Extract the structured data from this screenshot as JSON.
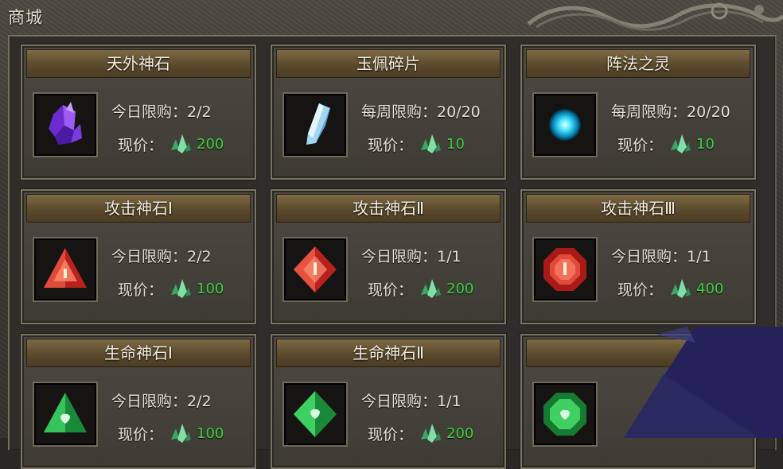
{
  "window": {
    "title": "商城"
  },
  "currency_icon": "green-crystal-icon",
  "colors": {
    "price": "#3fd13f",
    "header": "#6b5836",
    "panel": "#3e3b35"
  },
  "items": [
    {
      "name": "天外神石",
      "limit": "今日限购：2/2",
      "price_label": "现价：",
      "price": "200",
      "icon": "purple-crystal-icon"
    },
    {
      "name": "玉佩碎片",
      "limit": "每周限购：20/20",
      "price_label": "现价：",
      "price": "10",
      "icon": "jade-shard-icon"
    },
    {
      "name": "阵法之灵",
      "limit": "每周限购：20/20",
      "price_label": "现价：",
      "price": "10",
      "icon": "blue-orb-icon"
    },
    {
      "name": "攻击神石Ⅰ",
      "limit": "今日限购：2/2",
      "price_label": "现价：",
      "price": "100",
      "icon": "red-triangle-gem-icon"
    },
    {
      "name": "攻击神石Ⅱ",
      "limit": "今日限购：1/1",
      "price_label": "现价：",
      "price": "200",
      "icon": "red-diamond-gem-icon"
    },
    {
      "name": "攻击神石Ⅲ",
      "limit": "今日限购：1/1",
      "price_label": "现价：",
      "price": "400",
      "icon": "red-octagon-gem-icon"
    },
    {
      "name": "生命神石Ⅰ",
      "limit": "今日限购：2/2",
      "price_label": "现价：",
      "price": "100",
      "icon": "green-triangle-gem-icon"
    },
    {
      "name": "生命神石Ⅱ",
      "limit": "今日限购：1/1",
      "price_label": "现价：",
      "price": "200",
      "icon": "green-diamond-gem-icon"
    },
    {
      "name": "",
      "limit": "",
      "price_label": "",
      "price": "",
      "icon": "green-octagon-gem-icon"
    }
  ]
}
